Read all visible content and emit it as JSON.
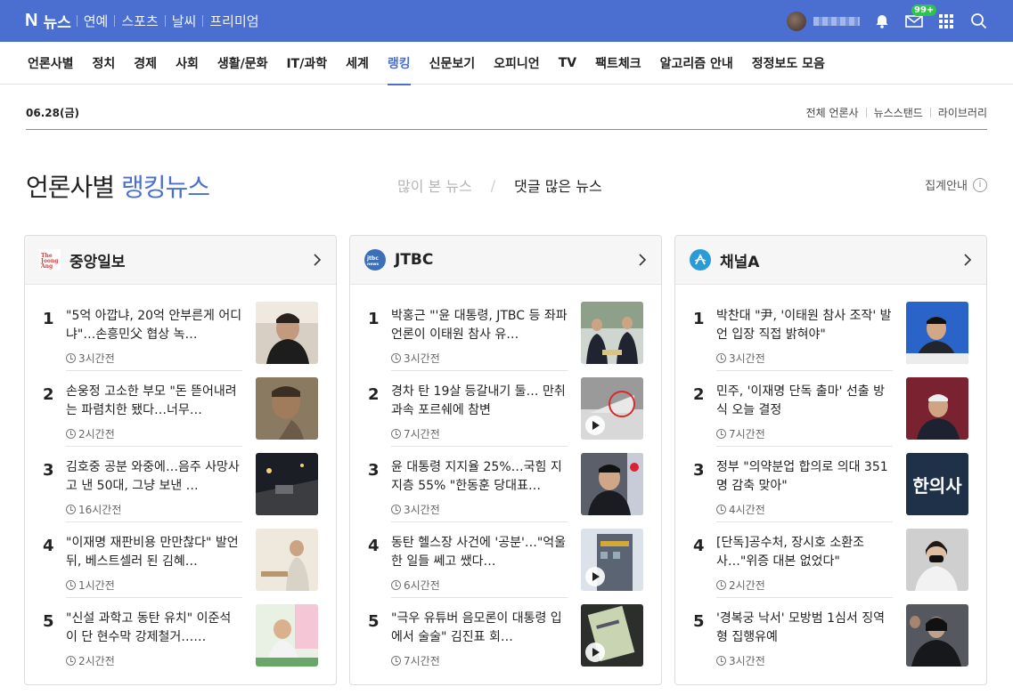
{
  "header": {
    "logo_n": "N",
    "logo_text": "뉴스",
    "links": [
      "연예",
      "스포츠",
      "날씨",
      "프리미엄"
    ],
    "mail_badge": "99+"
  },
  "nav": {
    "items": [
      "언론사별",
      "정치",
      "경제",
      "사회",
      "생활/문화",
      "IT/과학",
      "세계",
      "랭킹",
      "신문보기",
      "오피니언",
      "TV",
      "팩트체크",
      "알고리즘 안내",
      "정정보도 모음"
    ],
    "active_index": 7
  },
  "subhead": {
    "date": "06.28(금)",
    "links": [
      "전체 언론사",
      "뉴스스탠드",
      "라이브러리"
    ]
  },
  "title": {
    "main": "언론사별 ",
    "accent": "랭킹뉴스",
    "tab_inactive": "많이 본 뉴스",
    "tab_slash": "/",
    "tab_active": "댓글 많은 뉴스",
    "info": "집계안내",
    "info_icon": "i"
  },
  "colors": {
    "brand": "#4a6fd1"
  },
  "cards": [
    {
      "press": "중앙일보",
      "logo_text": "The JoongAng",
      "items": [
        {
          "rank": "1",
          "headline": "\"5억 아깝냐, 20억 안부른게 어디냐\"…손흥민父 협상 녹…",
          "time": "3시간전"
        },
        {
          "rank": "2",
          "headline": "손웅정 고소한 부모 \"돈 뜯어내려는 파렴치한 됐다…너무…",
          "time": "2시간전"
        },
        {
          "rank": "3",
          "headline": "김호중 공분 와중에…음주 사망사고 낸 50대, 그냥 보낸 …",
          "time": "16시간전"
        },
        {
          "rank": "4",
          "headline": "\"이재명 재판비용 만만찮다\" 발언뒤, 베스트셀러 된 김혜…",
          "time": "1시간전"
        },
        {
          "rank": "5",
          "headline": "\"신설 과학고 동탄 유치\" 이준석이 단 현수막 강제철거……",
          "time": "2시간전"
        }
      ]
    },
    {
      "press": "JTBC",
      "logo_text": "jtbc news",
      "items": [
        {
          "rank": "1",
          "headline": "박홍근 \"'윤 대통령, JTBC 등 좌파언론이 이태원 참사 유…",
          "time": "3시간전"
        },
        {
          "rank": "2",
          "headline": "경차 탄 19살 등갈내기 둘… 만취 과속 포르쉐에 참변",
          "time": "7시간전"
        },
        {
          "rank": "3",
          "headline": "윤 대통령 지지율 25%…국힘 지지층 55% \"한동훈 당대표…",
          "time": "3시간전"
        },
        {
          "rank": "4",
          "headline": "동탄 헬스장 사건에 '공분'…\"억울한 일들 쎄고 쌨다…",
          "time": "6시간전"
        },
        {
          "rank": "5",
          "headline": "\"극우 유튜버 음모론이 대통령 입에서 술술\" 김진표 회…",
          "time": "7시간전"
        }
      ]
    },
    {
      "press": "채널A",
      "logo_text": "A",
      "items": [
        {
          "rank": "1",
          "headline": "박찬대 \"尹, '이태원 참사 조작' 발언 입장 직접 밝혀야\"",
          "time": "3시간전"
        },
        {
          "rank": "2",
          "headline": "민주, '이재명 단독 출마' 선출 방식 오늘 결정",
          "time": "7시간전"
        },
        {
          "rank": "3",
          "headline": "정부 \"의약분업 합의로 의대 351명 감축 맞아\"",
          "time": "4시간전"
        },
        {
          "rank": "4",
          "headline": "[단독]공수처, 장시호 소환조사…\"위증 대본 없었다\"",
          "time": "2시간전"
        },
        {
          "rank": "5",
          "headline": "'경복궁 낙서' 모방범 1심서 징역형 집행유예",
          "time": "3시간전"
        }
      ]
    }
  ],
  "thumb_text": {
    "c2_3": "한의사"
  }
}
